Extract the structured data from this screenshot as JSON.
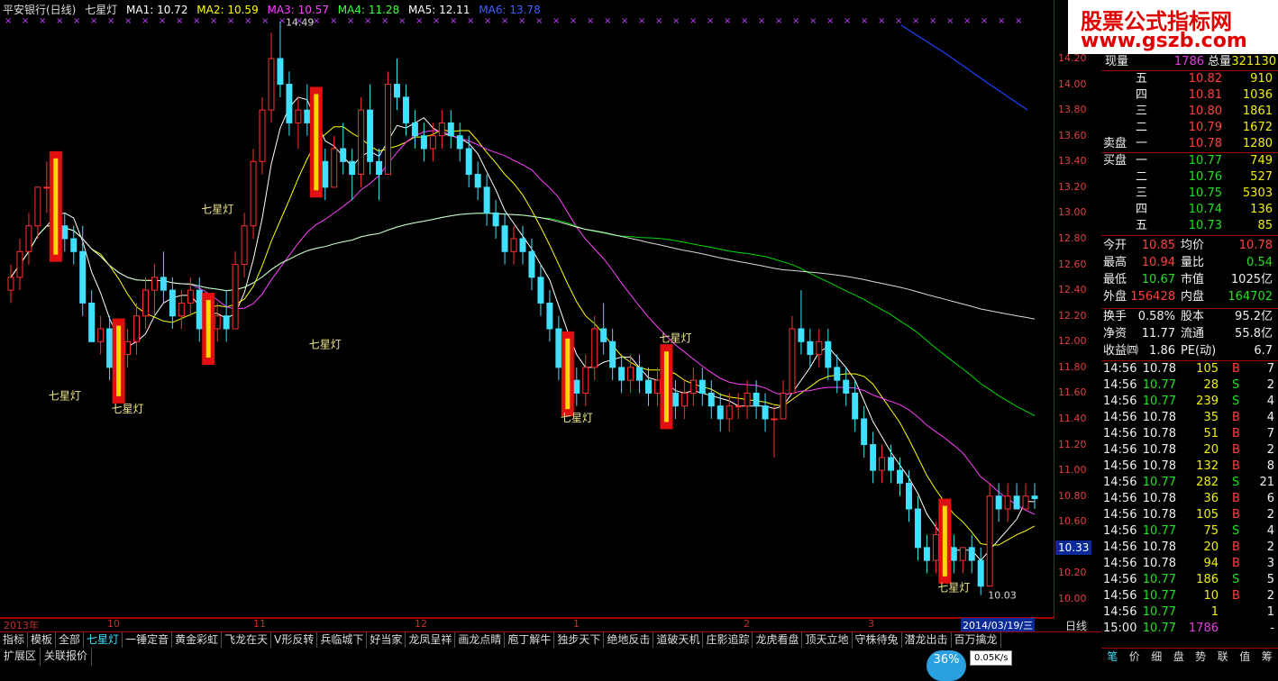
{
  "legend": {
    "title": "平安银行(日线)",
    "indicator": "七星灯",
    "ma1": "MA1: 10.72",
    "ma2": "MA2: 10.59",
    "ma3": "MA3: 10.57",
    "ma4": "MA4: 11.28",
    "ma5": "MA5: 12.11",
    "ma6": "MA6: 13.78",
    "colors": {
      "ma1": "#ffffff",
      "ma2": "#ffff00",
      "ma3": "#ff40ff",
      "ma4": "#00ff00",
      "ma5": "#ffffff",
      "ma6": "#4060ff"
    }
  },
  "signal_label": "七星灯",
  "annot_high": "14.49",
  "annot_low": "10.03",
  "yaxis": [
    "14.20",
    "14.00",
    "13.80",
    "13.60",
    "13.40",
    "13.20",
    "13.00",
    "12.80",
    "12.60",
    "12.40",
    "12.20",
    "12.00",
    "11.80",
    "11.60",
    "11.40",
    "11.20",
    "11.00",
    "10.80",
    "10.60",
    "10.40",
    "10.20",
    "10.00"
  ],
  "current_price_tag": "10.33",
  "date_axis": {
    "year": "2013年",
    "m10": "10",
    "m11": "11",
    "m12": "12",
    "m1": "1",
    "m2": "2",
    "m3": "3",
    "current": "2014/03/19/三",
    "cycle": "日线"
  },
  "tabs": [
    "指标",
    "模板",
    "全部",
    "七星灯",
    "一锤定音",
    "黄金彩虹",
    "飞龙在天",
    "V形反转",
    "兵临城下",
    "好当家",
    "龙凤呈祥",
    "画龙点睛",
    "庖丁解牛",
    "独步天下",
    "绝地反击",
    "道破天机",
    "庄影追踪",
    "龙虎看盘",
    "顶天立地",
    "守株待兔",
    "潜龙出击",
    "百万擒龙"
  ],
  "active_tab": "七星灯",
  "ext": [
    "扩展区",
    "关联报价"
  ],
  "logo": {
    "line1": "股票公式指标网",
    "line2": "www.gszb.com"
  },
  "quote": {
    "xianliang_lbl": "现量",
    "xianliang": "1786",
    "zongliang_lbl": "总量",
    "zongliang": "321130",
    "sell": [
      {
        "l": "五",
        "p": "10.82",
        "v": "910"
      },
      {
        "l": "四",
        "p": "10.81",
        "v": "1036"
      },
      {
        "l": "三",
        "p": "10.80",
        "v": "1861"
      },
      {
        "l": "二",
        "p": "10.79",
        "v": "1672"
      },
      {
        "l": "一",
        "p": "10.78",
        "v": "1280"
      }
    ],
    "sell_lbl": "卖盘",
    "buy_lbl": "买盘",
    "buy": [
      {
        "l": "一",
        "p": "10.77",
        "v": "749"
      },
      {
        "l": "二",
        "p": "10.76",
        "v": "527"
      },
      {
        "l": "三",
        "p": "10.75",
        "v": "5303"
      },
      {
        "l": "四",
        "p": "10.74",
        "v": "136"
      },
      {
        "l": "五",
        "p": "10.73",
        "v": "85"
      }
    ],
    "stats": [
      {
        "a": "今开",
        "av": "10.85",
        "b": "均价",
        "bv": "10.78"
      },
      {
        "a": "最高",
        "av": "10.94",
        "b": "量比",
        "bv": "0.54"
      },
      {
        "a": "最低",
        "av": "10.67",
        "b": "市值",
        "bv": "1025亿"
      },
      {
        "a": "外盘",
        "av": "156428",
        "b": "内盘",
        "bv": "164702"
      }
    ],
    "fund": [
      {
        "a": "换手",
        "av": "0.58%",
        "b": "股本",
        "bv": "95.2亿"
      },
      {
        "a": "净资",
        "av": "11.77",
        "b": "流通",
        "bv": "55.8亿"
      },
      {
        "a": "收益㈣",
        "av": "1.86",
        "b": "PE(动)",
        "bv": "6.7"
      }
    ],
    "ticks": [
      {
        "t": "14:56",
        "p": "10.78",
        "v": "105",
        "s": "B",
        "n": "7"
      },
      {
        "t": "14:56",
        "p": "10.77",
        "v": "28",
        "s": "S",
        "n": "2"
      },
      {
        "t": "14:56",
        "p": "10.77",
        "v": "239",
        "s": "S",
        "n": "4"
      },
      {
        "t": "14:56",
        "p": "10.78",
        "v": "35",
        "s": "B",
        "n": "4"
      },
      {
        "t": "14:56",
        "p": "10.78",
        "v": "51",
        "s": "B",
        "n": "7"
      },
      {
        "t": "14:56",
        "p": "10.78",
        "v": "20",
        "s": "B",
        "n": "2"
      },
      {
        "t": "14:56",
        "p": "10.78",
        "v": "132",
        "s": "B",
        "n": "8"
      },
      {
        "t": "14:56",
        "p": "10.77",
        "v": "282",
        "s": "S",
        "n": "21"
      },
      {
        "t": "14:56",
        "p": "10.78",
        "v": "36",
        "s": "B",
        "n": "6"
      },
      {
        "t": "14:56",
        "p": "10.78",
        "v": "105",
        "s": "B",
        "n": "2"
      },
      {
        "t": "14:56",
        "p": "10.77",
        "v": "75",
        "s": "S",
        "n": "4"
      },
      {
        "t": "14:56",
        "p": "10.78",
        "v": "20",
        "s": "B",
        "n": "2"
      },
      {
        "t": "14:56",
        "p": "10.78",
        "v": "94",
        "s": "B",
        "n": "3"
      },
      {
        "t": "14:56",
        "p": "10.77",
        "v": "186",
        "s": "S",
        "n": "5"
      },
      {
        "t": "14:56",
        "p": "10.77",
        "v": "10",
        "s": "B",
        "n": "2"
      },
      {
        "t": "14:56",
        "p": "10.77",
        "v": "1",
        "s": "",
        "n": "1"
      },
      {
        "t": "15:00",
        "p": "10.77",
        "v": "1786",
        "s": "",
        "n": "-"
      }
    ]
  },
  "panel_tabs": [
    "笔",
    "价",
    "细",
    "盘",
    "势",
    "联",
    "值",
    "筹"
  ],
  "cpu": "36%",
  "netspeed": "0.05K/s",
  "chart_data": {
    "type": "candlestick",
    "ylim": [
      10.0,
      14.2
    ],
    "log_like": false,
    "up_color": "#ff3030",
    "down_color": "#40e0ff",
    "candles": [
      [
        12.4,
        12.6,
        12.3,
        12.5
      ],
      [
        12.5,
        12.8,
        12.4,
        12.7
      ],
      [
        12.7,
        13.0,
        12.6,
        12.9
      ],
      [
        12.9,
        13.2,
        12.8,
        13.2
      ],
      [
        13.2,
        13.4,
        13.0,
        13.2
      ],
      [
        13.2,
        13.3,
        12.8,
        12.9
      ],
      [
        12.9,
        13.0,
        12.7,
        12.8
      ],
      [
        12.8,
        12.9,
        12.6,
        12.7
      ],
      [
        12.7,
        12.9,
        12.2,
        12.3
      ],
      [
        12.3,
        12.4,
        12.0,
        12.0
      ],
      [
        12.0,
        12.2,
        11.9,
        12.1
      ],
      [
        12.1,
        12.2,
        11.7,
        11.8
      ],
      [
        11.8,
        12.0,
        11.7,
        11.9
      ],
      [
        11.9,
        12.1,
        11.8,
        12.0
      ],
      [
        12.0,
        12.3,
        11.9,
        12.2
      ],
      [
        12.2,
        12.5,
        12.1,
        12.4
      ],
      [
        12.4,
        12.6,
        12.2,
        12.5
      ],
      [
        12.5,
        12.7,
        12.3,
        12.4
      ],
      [
        12.4,
        12.5,
        12.1,
        12.2
      ],
      [
        12.2,
        12.4,
        12.1,
        12.3
      ],
      [
        12.3,
        12.5,
        12.2,
        12.4
      ],
      [
        12.4,
        12.5,
        12.0,
        12.1
      ],
      [
        12.1,
        12.2,
        12.0,
        12.1
      ],
      [
        12.1,
        12.3,
        12.0,
        12.2
      ],
      [
        12.2,
        12.4,
        12.0,
        12.1
      ],
      [
        12.1,
        12.7,
        12.1,
        12.6
      ],
      [
        12.6,
        13.0,
        12.5,
        12.9
      ],
      [
        12.9,
        13.5,
        12.8,
        13.4
      ],
      [
        13.4,
        13.9,
        13.3,
        13.8
      ],
      [
        13.8,
        14.4,
        13.7,
        14.2
      ],
      [
        14.2,
        14.49,
        13.9,
        14.0
      ],
      [
        14.0,
        14.1,
        13.6,
        13.7
      ],
      [
        13.7,
        13.9,
        13.5,
        13.8
      ],
      [
        13.8,
        14.0,
        13.6,
        13.7
      ],
      [
        13.7,
        13.8,
        13.3,
        13.4
      ],
      [
        13.4,
        13.5,
        13.1,
        13.2
      ],
      [
        13.2,
        13.6,
        13.2,
        13.5
      ],
      [
        13.5,
        13.7,
        13.3,
        13.4
      ],
      [
        13.4,
        13.5,
        13.1,
        13.3
      ],
      [
        13.3,
        13.9,
        13.2,
        13.8
      ],
      [
        13.8,
        14.0,
        13.3,
        13.4
      ],
      [
        13.4,
        13.5,
        13.1,
        13.3
      ],
      [
        13.3,
        14.1,
        13.3,
        14.0
      ],
      [
        14.0,
        14.2,
        13.8,
        13.9
      ],
      [
        13.9,
        14.0,
        13.6,
        13.7
      ],
      [
        13.7,
        13.8,
        13.5,
        13.6
      ],
      [
        13.6,
        13.7,
        13.4,
        13.5
      ],
      [
        13.5,
        13.7,
        13.4,
        13.6
      ],
      [
        13.6,
        13.8,
        13.5,
        13.7
      ],
      [
        13.7,
        13.8,
        13.5,
        13.6
      ],
      [
        13.6,
        13.7,
        13.4,
        13.5
      ],
      [
        13.5,
        13.6,
        13.2,
        13.3
      ],
      [
        13.3,
        13.4,
        13.1,
        13.2
      ],
      [
        13.2,
        13.3,
        12.9,
        13.0
      ],
      [
        13.0,
        13.1,
        12.8,
        12.9
      ],
      [
        12.9,
        13.0,
        12.6,
        12.7
      ],
      [
        12.7,
        12.9,
        12.6,
        12.8
      ],
      [
        12.8,
        12.9,
        12.6,
        12.7
      ],
      [
        12.7,
        12.8,
        12.4,
        12.5
      ],
      [
        12.5,
        12.6,
        12.2,
        12.3
      ],
      [
        12.3,
        12.4,
        12.0,
        12.1
      ],
      [
        12.1,
        12.2,
        11.7,
        11.8
      ],
      [
        11.8,
        11.9,
        11.6,
        11.7
      ],
      [
        11.7,
        11.8,
        11.5,
        11.6
      ],
      [
        11.6,
        11.9,
        11.5,
        11.8
      ],
      [
        11.8,
        12.2,
        11.7,
        12.1
      ],
      [
        12.1,
        12.3,
        11.9,
        12.0
      ],
      [
        12.0,
        12.1,
        11.7,
        11.8
      ],
      [
        11.8,
        11.9,
        11.6,
        11.7
      ],
      [
        11.7,
        11.9,
        11.6,
        11.8
      ],
      [
        11.8,
        11.9,
        11.6,
        11.7
      ],
      [
        11.7,
        11.8,
        11.5,
        11.6
      ],
      [
        11.6,
        11.8,
        11.5,
        11.7
      ],
      [
        11.7,
        11.8,
        11.5,
        11.6
      ],
      [
        11.6,
        11.7,
        11.4,
        11.5
      ],
      [
        11.5,
        11.7,
        11.4,
        11.6
      ],
      [
        11.6,
        11.8,
        11.5,
        11.7
      ],
      [
        11.7,
        11.8,
        11.5,
        11.6
      ],
      [
        11.6,
        11.7,
        11.4,
        11.5
      ],
      [
        11.5,
        11.6,
        11.3,
        11.4
      ],
      [
        11.4,
        11.6,
        11.3,
        11.5
      ],
      [
        11.5,
        11.6,
        11.4,
        11.5
      ],
      [
        11.5,
        11.7,
        11.4,
        11.6
      ],
      [
        11.6,
        11.7,
        11.4,
        11.5
      ],
      [
        11.5,
        11.6,
        11.3,
        11.4
      ],
      [
        11.4,
        11.5,
        11.1,
        11.4
      ],
      [
        11.4,
        11.7,
        11.4,
        11.6
      ],
      [
        11.6,
        12.2,
        11.6,
        12.1
      ],
      [
        12.1,
        12.4,
        11.9,
        12.0
      ],
      [
        12.0,
        12.1,
        11.8,
        11.9
      ],
      [
        11.9,
        12.1,
        11.8,
        12.0
      ],
      [
        12.0,
        12.1,
        11.7,
        11.8
      ],
      [
        11.8,
        11.9,
        11.6,
        11.7
      ],
      [
        11.7,
        11.8,
        11.5,
        11.6
      ],
      [
        11.6,
        11.7,
        11.3,
        11.4
      ],
      [
        11.4,
        11.5,
        11.1,
        11.2
      ],
      [
        11.2,
        11.3,
        10.9,
        11.0
      ],
      [
        11.0,
        11.2,
        10.9,
        11.1
      ],
      [
        11.1,
        11.2,
        10.9,
        11.0
      ],
      [
        11.0,
        11.1,
        10.8,
        10.9
      ],
      [
        10.9,
        11.0,
        10.6,
        10.7
      ],
      [
        10.7,
        10.8,
        10.3,
        10.4
      ],
      [
        10.4,
        10.5,
        10.2,
        10.3
      ],
      [
        10.3,
        10.6,
        10.2,
        10.5
      ],
      [
        10.5,
        10.6,
        10.3,
        10.4
      ],
      [
        10.4,
        10.5,
        10.2,
        10.3
      ],
      [
        10.3,
        10.4,
        10.2,
        10.4
      ],
      [
        10.4,
        10.5,
        10.2,
        10.3
      ],
      [
        10.3,
        10.4,
        10.03,
        10.1
      ],
      [
        10.1,
        10.9,
        10.1,
        10.8
      ],
      [
        10.8,
        10.9,
        10.6,
        10.7
      ],
      [
        10.7,
        10.9,
        10.6,
        10.8
      ],
      [
        10.8,
        10.9,
        10.7,
        10.7
      ],
      [
        10.7,
        10.9,
        10.7,
        10.8
      ],
      [
        10.8,
        10.9,
        10.7,
        10.78
      ]
    ],
    "signals": [
      5,
      12,
      22,
      34,
      62,
      73,
      104
    ],
    "signal_levels": [
      11.55,
      11.45,
      13.0,
      11.95,
      11.38,
      12.0,
      10.06
    ]
  }
}
